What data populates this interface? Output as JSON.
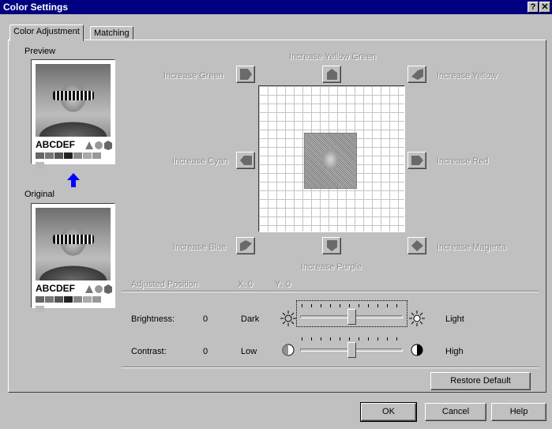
{
  "window": {
    "title": "Color Settings",
    "help_glyph": "?",
    "close_glyph": "✕"
  },
  "tabs": [
    {
      "label": "Color Adjustment",
      "active": true
    },
    {
      "label": "Matching",
      "active": false
    }
  ],
  "preview": {
    "label": "Preview",
    "sample_text": "ABCDEF"
  },
  "original": {
    "label": "Original",
    "sample_text": "ABCDEF"
  },
  "arrow_color": "#0000ff",
  "adjust": {
    "increase_green": "Increase Green",
    "increase_yellow_green": "Increase Yellow Green",
    "increase_yellow": "Increase Yellow",
    "increase_cyan": "Increase Cyan",
    "increase_red": "Increase Red",
    "increase_blue": "Increase Blue",
    "increase_purple": "Increase Purple",
    "increase_magenta": "Increase Magenta"
  },
  "position": {
    "label": "Adjusted Position",
    "x_label": "X:",
    "x_value": "0",
    "y_label": "Y:",
    "y_value": "0"
  },
  "brightness": {
    "label": "Brightness:",
    "value": "0",
    "min_label": "Dark",
    "max_label": "Light",
    "level": 0.5
  },
  "contrast": {
    "label": "Contrast:",
    "value": "0",
    "min_label": "Low",
    "max_label": "High",
    "level": 0.5
  },
  "buttons": {
    "restore_default": "Restore Default",
    "ok": "OK",
    "cancel": "Cancel",
    "help": "Help"
  }
}
